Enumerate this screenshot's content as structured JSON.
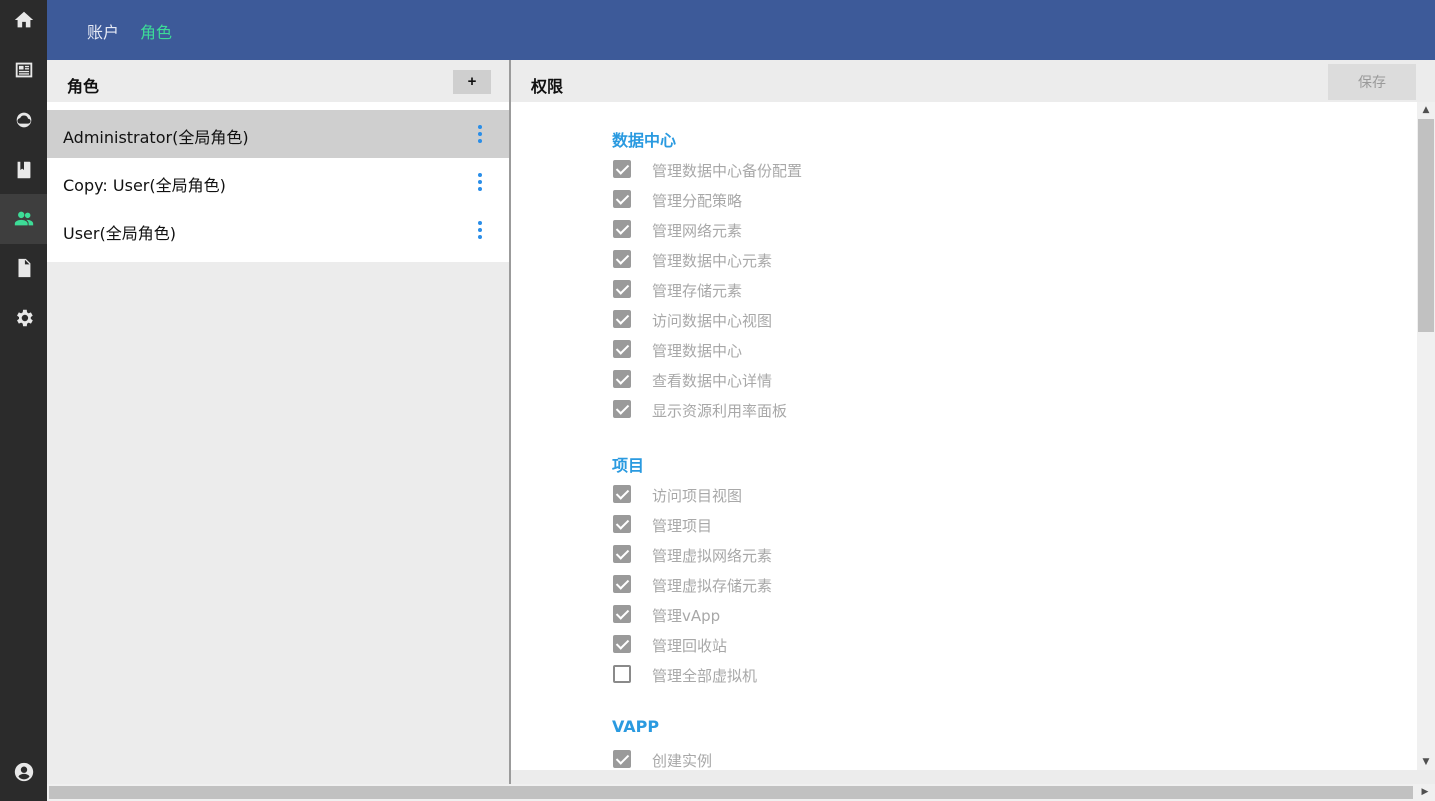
{
  "rail": {
    "items": [
      {
        "icon": "home-icon"
      },
      {
        "icon": "dashboard-icon"
      },
      {
        "icon": "cloud-icon"
      },
      {
        "icon": "book-icon"
      },
      {
        "icon": "users-icon",
        "active": true
      },
      {
        "icon": "document-icon"
      },
      {
        "icon": "gear-icon"
      }
    ],
    "bottom_icon": "account-circle-icon"
  },
  "header": {
    "tabs": [
      {
        "label": "账户"
      },
      {
        "label": "角色",
        "active": true
      }
    ]
  },
  "roles": {
    "title": "角色",
    "add_label": "+",
    "items": [
      {
        "name": "Administrator(全局角色)",
        "selected": true
      },
      {
        "name": "Copy: User(全局角色)"
      },
      {
        "name": "User(全局角色)"
      }
    ]
  },
  "permissions": {
    "title": "权限",
    "save_label": "保存",
    "sections": [
      {
        "title": "数据中心",
        "items": [
          {
            "label": "管理数据中心备份配置",
            "checked": true
          },
          {
            "label": "管理分配策略",
            "checked": true
          },
          {
            "label": "管理网络元素",
            "checked": true
          },
          {
            "label": "管理数据中心元素",
            "checked": true
          },
          {
            "label": "管理存储元素",
            "checked": true
          },
          {
            "label": "访问数据中心视图",
            "checked": true
          },
          {
            "label": "管理数据中心",
            "checked": true
          },
          {
            "label": "查看数据中心详情",
            "checked": true
          },
          {
            "label": "显示资源利用率面板",
            "checked": true
          }
        ]
      },
      {
        "title": "项目",
        "items": [
          {
            "label": "访问项目视图",
            "checked": true
          },
          {
            "label": "管理项目",
            "checked": true
          },
          {
            "label": "管理虚拟网络元素",
            "checked": true
          },
          {
            "label": "管理虚拟存储元素",
            "checked": true
          },
          {
            "label": "管理vApp",
            "checked": true
          },
          {
            "label": "管理回收站",
            "checked": true
          },
          {
            "label": "管理全部虚拟机",
            "checked": false
          }
        ]
      },
      {
        "title": "VAPP",
        "items": [
          {
            "label": "创建实例",
            "checked": true
          }
        ]
      }
    ]
  },
  "colors": {
    "header_bg": "#3d5a99",
    "accent_green": "#3ddc97",
    "section_blue": "#2a9ae0",
    "rail_bg": "#2b2b2b"
  }
}
